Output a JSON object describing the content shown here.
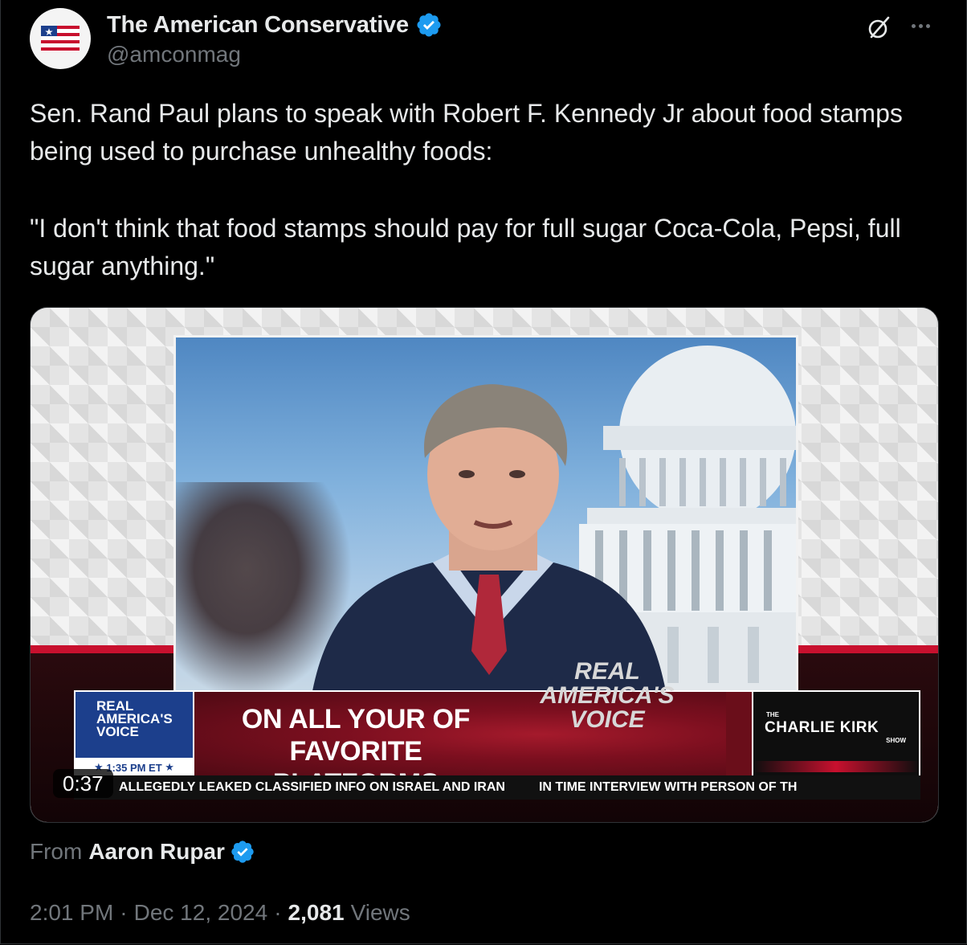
{
  "author": {
    "name": "The American Conservative",
    "handle": "@amconmag",
    "verified": true,
    "avatar_icon": "american-flag-logo"
  },
  "tweet": {
    "paragraphs": [
      "Sen. Rand Paul plans to speak with Robert F. Kennedy Jr about food stamps being used to purchase unhealthy foods:",
      "\"I don't think that food stamps should pay for full sugar Coca-Cola, Pepsi, full sugar anything.\""
    ]
  },
  "media": {
    "duration": "0:37",
    "lower_third": {
      "network_line1": "REAL",
      "network_line2": "AMERICA'S",
      "network_line3": "VOICE",
      "time": "1:35 PM ET",
      "message_line1": "ON ALL YOUR OF",
      "message_line2": "FAVORITE PLATFORMS",
      "logo_line1": "REAL",
      "logo_line2": "AMERICA'S",
      "logo_line3": "VOICE",
      "show_the": "THE",
      "show_name": "CHARLIE KIRK",
      "show_suffix": "SHOW"
    },
    "ticker": [
      "ALLEGEDLY LEAKED CLASSIFIED INFO ON ISRAEL AND IRAN",
      "IN TIME INTERVIEW WITH PERSON OF TH"
    ]
  },
  "source": {
    "from_label": "From",
    "name": "Aaron Rupar",
    "verified": true
  },
  "meta": {
    "time": "2:01 PM",
    "date": "Dec 12, 2024",
    "views_count": "2,081",
    "views_label": "Views"
  },
  "colors": {
    "background": "#000000",
    "verified_blue": "#1d9bf0",
    "secondary_text": "#71767b"
  }
}
